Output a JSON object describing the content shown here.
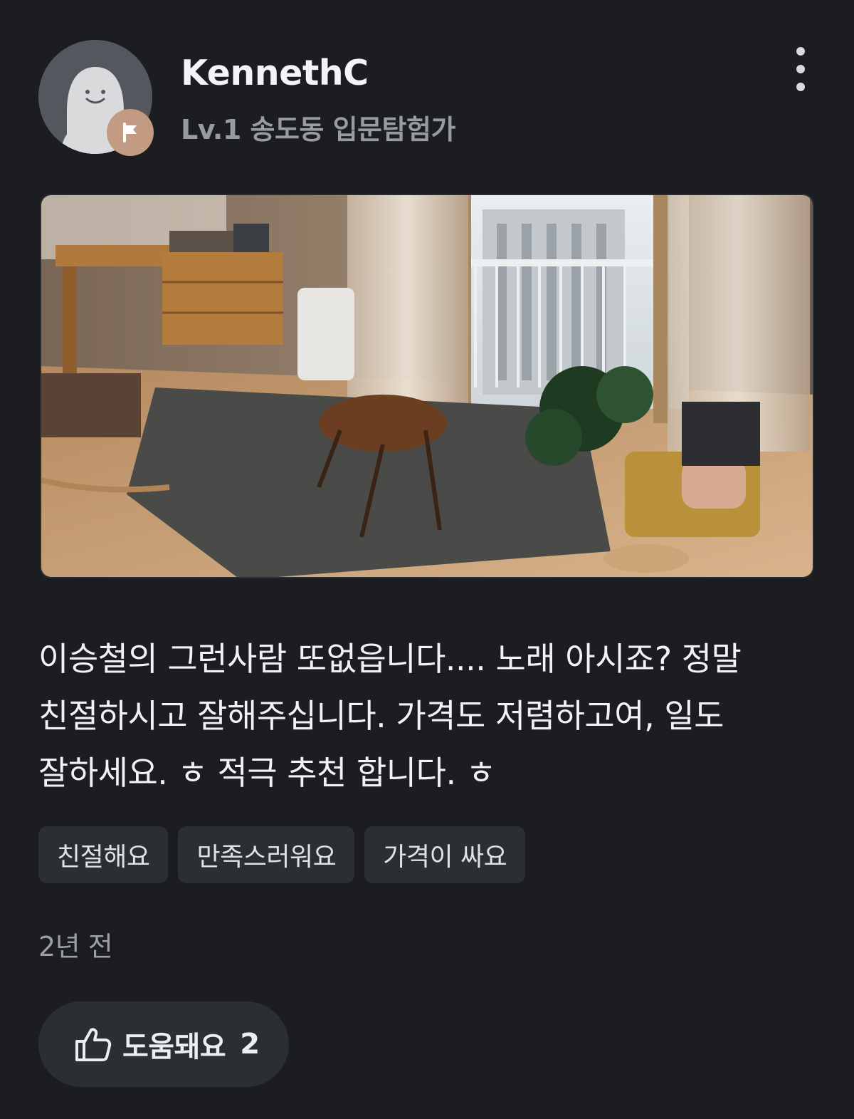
{
  "review": {
    "author": {
      "name": "KennethC",
      "level": "Lv.1 송도동 입문탐험가"
    },
    "photo_alt": "",
    "text_lines": [
      "이승철의 그런사람 또없읍니다.... 노래 아시죠? 정말",
      "친절하시고 잘해주십니다. 가격도 저렴하고여, 일도",
      "잘하세요. ㅎ 적극 추천 합니다. ㅎ"
    ],
    "tags": [
      "친절해요",
      "만족스러워요",
      "가격이 싸요"
    ],
    "time_ago": "2년 전",
    "helpful": {
      "label": "도움돼요",
      "count": "2"
    }
  },
  "colors": {
    "background": "#1b1d21",
    "chip": "#2b2e33",
    "avatar": "#54575d",
    "badge": "#c39a82"
  }
}
